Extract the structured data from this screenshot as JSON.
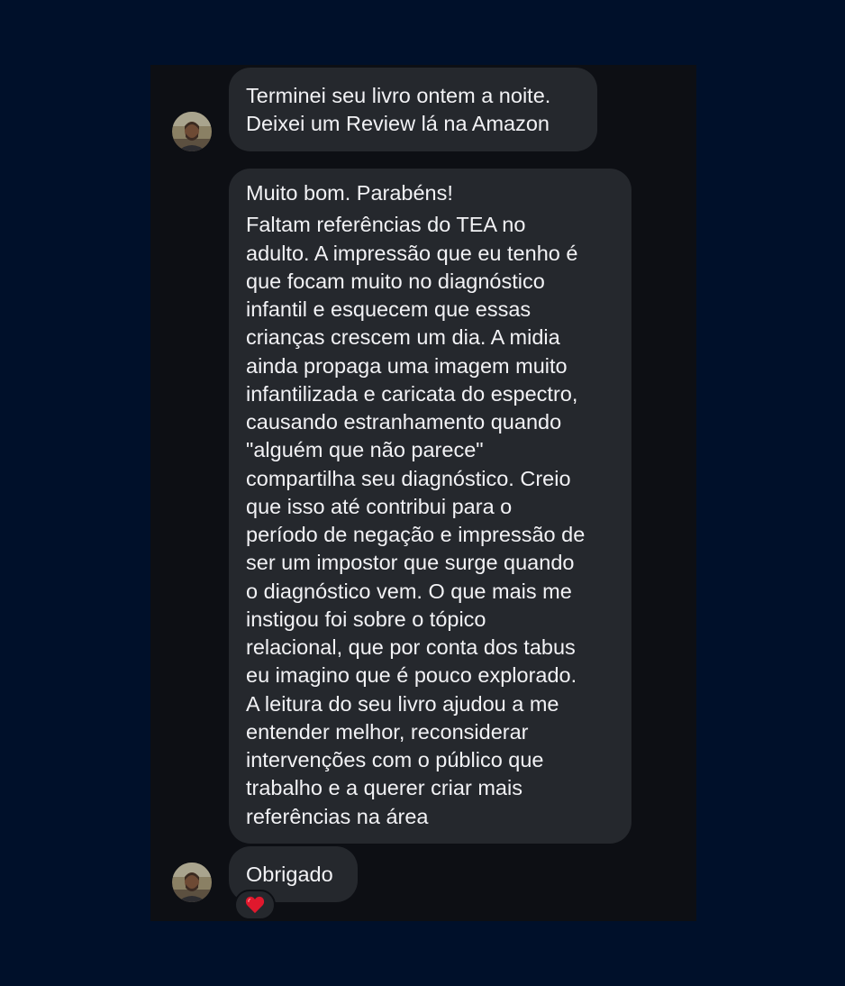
{
  "conversation": {
    "messages": [
      {
        "sender": "other",
        "show_avatar": true,
        "lines": [
          "Terminei seu livro ontem a noite.",
          "Deixei um Review lá na Amazon"
        ]
      },
      {
        "sender": "other",
        "show_avatar": false,
        "lines": [
          "Muito bom. Parabéns!",
          "Faltam referências do TEA no",
          "adulto. A impressão que eu tenho é",
          "que focam muito no diagnóstico",
          "infantil e esquecem que essas",
          "crianças crescem um dia. A midia",
          "ainda propaga uma imagem muito",
          "infantilizada e caricata do espectro,",
          "causando estranhamento quando",
          "\"alguém que não parece\"",
          "compartilha seu diagnóstico. Creio",
          "que isso até contribui para o",
          "período de negação e impressão de",
          "ser um impostor que surge quando",
          "o diagnóstico vem. O que mais me",
          "instigou foi sobre o tópico",
          "relacional, que por conta dos tabus",
          "eu imagino que é pouco explorado.",
          "A leitura do seu livro ajudou a me",
          "entender melhor, reconsiderar",
          "intervenções com o público que",
          "trabalho e a querer criar mais",
          "referências na área"
        ]
      },
      {
        "sender": "other",
        "show_avatar": true,
        "lines": [
          "Obrigado"
        ],
        "reaction": {
          "icon": "heart-icon",
          "color": "#e0182d"
        }
      }
    ]
  },
  "colors": {
    "background": "#00102a",
    "panel": "#0d0f14",
    "bubble": "#25282d",
    "text": "#f2f2f5"
  }
}
